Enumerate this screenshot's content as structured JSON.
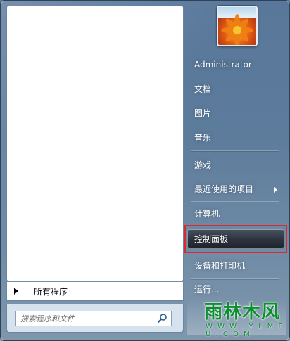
{
  "start_menu": {
    "all_programs_label": "所有程序",
    "search": {
      "placeholder": "搜索程序和文件"
    },
    "right_items": {
      "user": "Administrator",
      "documents": "文档",
      "pictures": "图片",
      "music": "音乐",
      "games": "游戏",
      "recent_items": "最近使用的项目",
      "computer": "计算机",
      "control_panel": "控制面板",
      "devices_printers": "设备和打印机",
      "run": "运行..."
    },
    "highlight_color": "#d92b2f"
  },
  "watermark": {
    "main": "雨林木风",
    "url": "W W W . Y L M F U . C O M"
  }
}
